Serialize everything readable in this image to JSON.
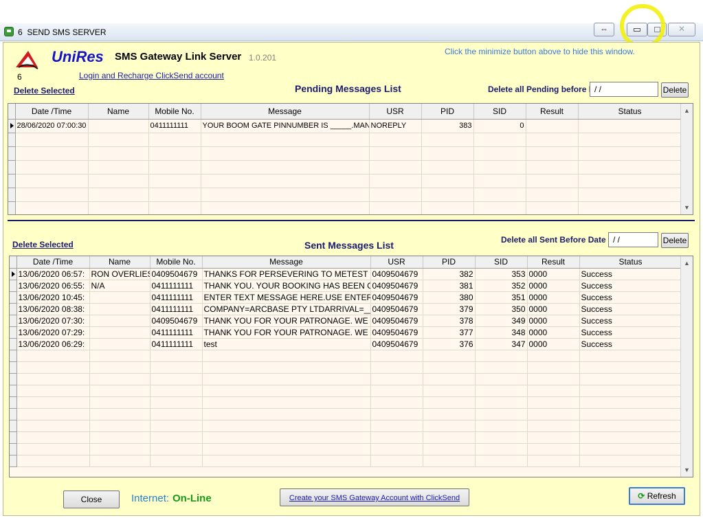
{
  "window": {
    "title": "6  SEND SMS SERVER",
    "controls": [
      "restore-arrows-icon",
      "minimize-icon",
      "maximize-icon",
      "close-icon"
    ]
  },
  "header": {
    "brand": "UniRes",
    "app_name": "SMS Gateway Link Server",
    "version": "1.0.201",
    "logo_number": "6",
    "hint": "Click the minimize button above to hide this window.",
    "login_link": "Login and Recharge ClickSend account"
  },
  "pending": {
    "delete_selected": "Delete Selected",
    "title": "Pending Messages List",
    "delete_before_label": "Delete all Pending before Date",
    "date_value": " / /",
    "delete_button": "Delete",
    "columns": [
      "Date /Time",
      "Name",
      "Mobile No.",
      "Message",
      "USR",
      "PID",
      "SID",
      "Result",
      "Status"
    ],
    "rows": [
      [
        "28/06/2020 07:00:30",
        "",
        "0411111111",
        "YOUR BOOM GATE PINNUMBER IS _____.MANAGER",
        "NOREPLY",
        "383",
        "0",
        "",
        ""
      ]
    ]
  },
  "sent": {
    "delete_selected": "Delete Selected",
    "title": "Sent Messages List",
    "delete_before_label": "Delete all Sent Before Date",
    "date_value": " / /",
    "delete_button": "Delete",
    "columns": [
      "Date /Time",
      "Name",
      "Mobile No.",
      "Message",
      "USR",
      "PID",
      "SID",
      "Result",
      "Status"
    ],
    "rows": [
      [
        "13/06/2020 06:57:",
        "RON OVERLIES",
        "0409504679",
        "THANKS FOR PERSEVERING TO METEST",
        "0409504679",
        "382",
        "353",
        "0000",
        "Success"
      ],
      [
        "13/06/2020 06:55:",
        "N/A",
        "0411111111",
        "THANK YOU. YOUR BOOKING HAS BEEN CO",
        "0409504679",
        "381",
        "352",
        "0000",
        "Success"
      ],
      [
        "13/06/2020 10:45:",
        "",
        "0411111111",
        "ENTER TEXT MESSAGE HERE.USE ENTER K",
        "0409504679",
        "380",
        "351",
        "0000",
        "Success"
      ],
      [
        "13/06/2020 08:38:",
        "",
        "0411111111",
        "COMPANY=ARCBASE PTY LTDARRIVAL=__",
        "0409504679",
        "379",
        "350",
        "0000",
        "Success"
      ],
      [
        "13/06/2020 07:30:",
        "",
        "0409504679",
        "THANK YOU FOR YOUR PATRONAGE. WE L",
        "0409504679",
        "378",
        "349",
        "0000",
        "Success"
      ],
      [
        "13/06/2020 07:29:",
        "",
        "0411111111",
        "THANK YOU FOR YOUR PATRONAGE. WE L",
        "0409504679",
        "377",
        "348",
        "0000",
        "Success"
      ],
      [
        "13/06/2020 06:29:",
        "",
        "0411111111",
        "test",
        "0409504679",
        "376",
        "347",
        "0000",
        "Success"
      ]
    ]
  },
  "footer": {
    "close_button": "Close",
    "internet_label": "Internet:",
    "internet_status": "On-Line",
    "create_account": "Create your SMS Gateway Account with ClickSend",
    "refresh_button": "Refresh"
  },
  "colors": {
    "panel_bg": "#ffffc8",
    "brand_blue": "#1414c8",
    "online_green": "#1a9a1a",
    "highlight_yellow": "#f2f000"
  }
}
